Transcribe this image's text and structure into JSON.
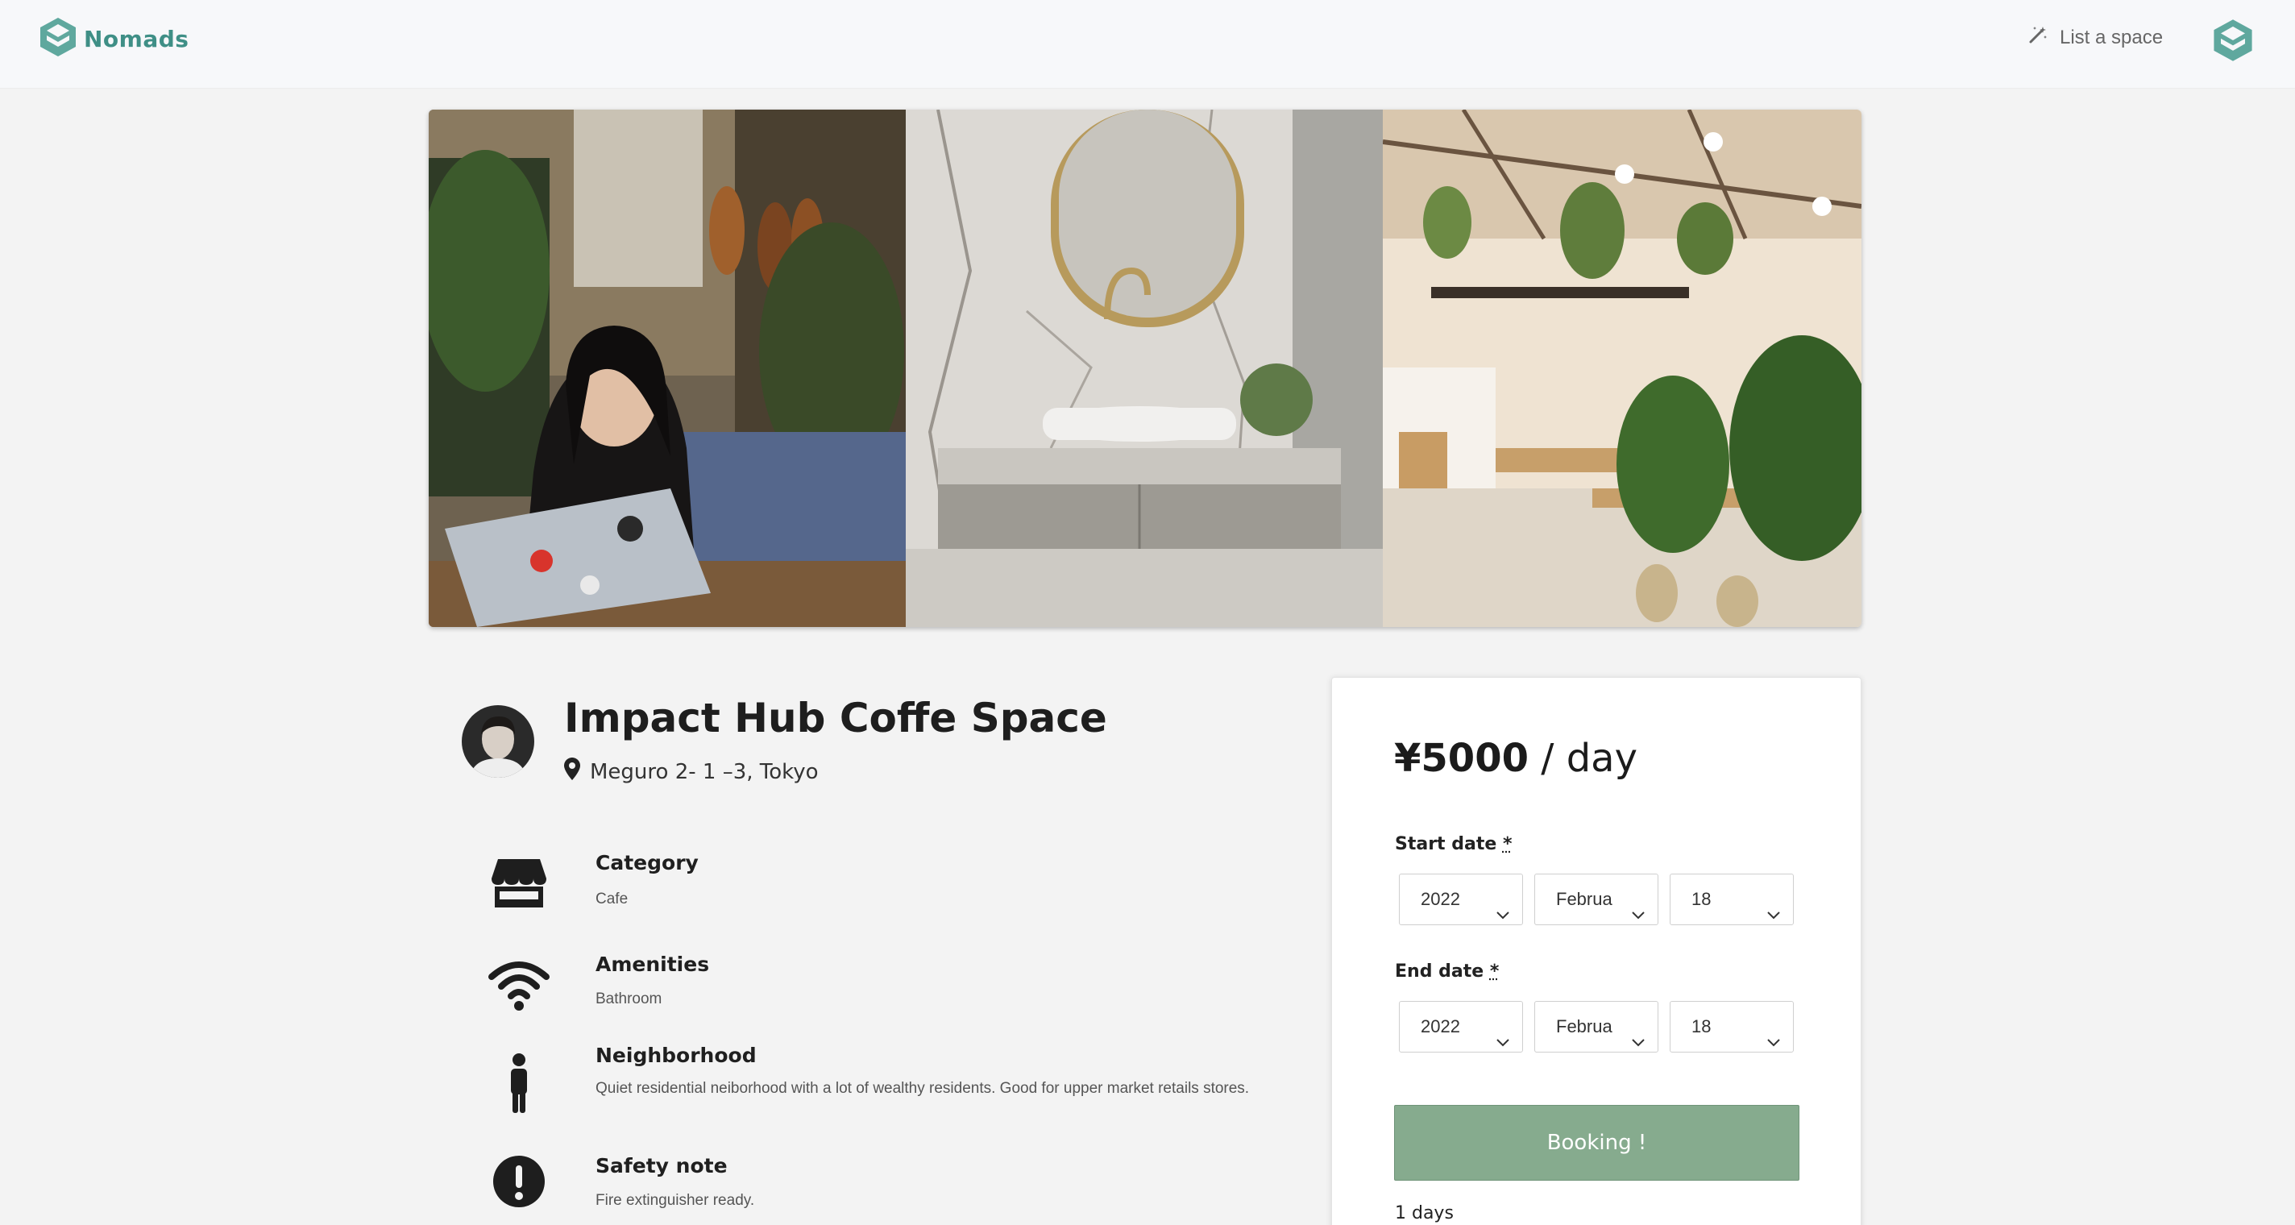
{
  "header": {
    "brand_name": "Nomads",
    "brand_icon": "nomads-logo-icon",
    "list_space_label": "List a space",
    "list_space_icon": "magic-wand-icon",
    "user_avatar_icon": "nomads-logo-icon",
    "accent_color": "#3f8f86"
  },
  "gallery": {
    "photos": [
      "woman-with-laptop-photo",
      "marble-bathroom-photo",
      "plant-filled-cafe-photo"
    ]
  },
  "listing": {
    "title": "Impact Hub Coffe Space",
    "address": "Meguro 2- 1 –3, Tokyo",
    "host_avatar": "host-avatar"
  },
  "features": [
    {
      "icon": "storefront-icon",
      "title": "Category",
      "text": "Cafe"
    },
    {
      "icon": "wifi-icon",
      "title": "Amenities",
      "text": "Bathroom"
    },
    {
      "icon": "person-icon",
      "title": "Neighborhood",
      "text": "Quiet residential neiborhood with a lot of wealthy residents. Good for upper market retails stores."
    },
    {
      "icon": "exclamation-circle-icon",
      "title": "Safety note",
      "text": "Fire extinguisher ready."
    }
  ],
  "booking": {
    "price_amount": "¥5000",
    "price_unit": " / day",
    "start_label": "Start date",
    "end_label": "End date",
    "required_marker": "*",
    "start": {
      "year": "2022",
      "month": "Februa",
      "day": "18"
    },
    "end": {
      "year": "2022",
      "month": "Februa",
      "day": "18"
    },
    "button_label": "Booking !",
    "button_color": "#86ab8e",
    "duration": "1 days"
  }
}
